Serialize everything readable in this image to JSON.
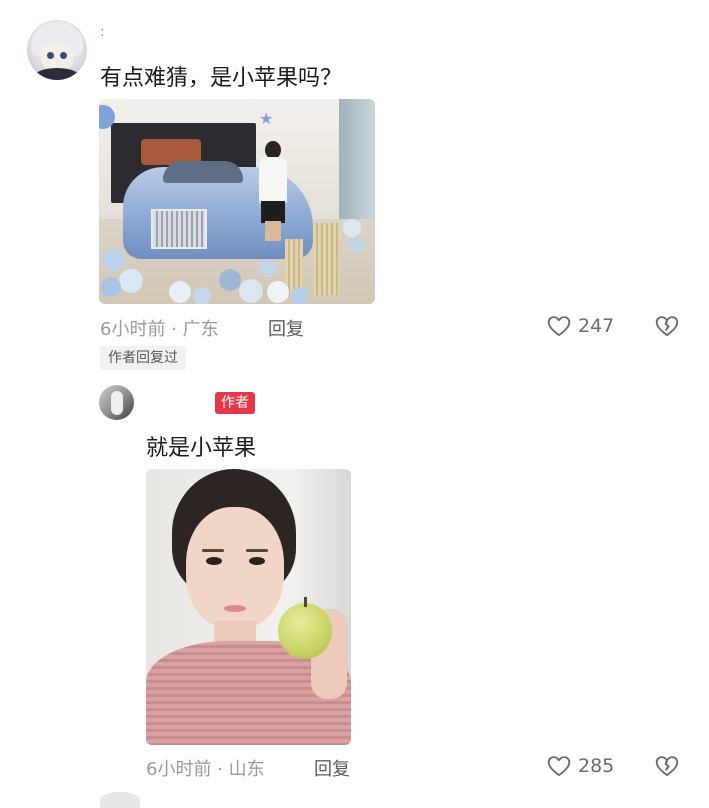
{
  "comment": {
    "username_marker": ":",
    "text": "有点难猜，是小苹果吗？",
    "meta": "6小时前 · 广东",
    "reply_label": "回复",
    "like_count": "247",
    "author_replied_badge": "作者回复过"
  },
  "reply": {
    "author_badge": "作者",
    "text": "就是小苹果",
    "meta": "6小时前 · 山东",
    "reply_label": "回复",
    "like_count": "285"
  },
  "icons": {
    "like": "heart-outline-icon",
    "dislike": "broken-heart-icon"
  }
}
